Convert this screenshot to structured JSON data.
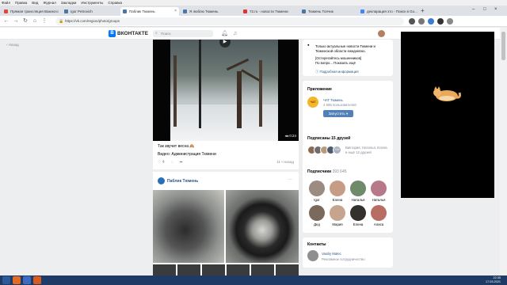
{
  "menubar": [
    "Файл",
    "Правка",
    "Вид",
    "Журнал",
    "Закладки",
    "Инструменты",
    "Справка"
  ],
  "tabs": [
    {
      "title": "Прямая трансляция Важного",
      "active": false
    },
    {
      "title": "Igor Petrovich",
      "active": false
    },
    {
      "title": "Паблик Тюмень",
      "active": true
    },
    {
      "title": "Я люблю Тюмень",
      "active": false
    },
    {
      "title": "72.ru - новости Тюмени",
      "active": false
    },
    {
      "title": "Тюмень Топчик",
      "active": false
    },
    {
      "title": "декларация это - Поиск в Go...",
      "active": false
    }
  ],
  "address": {
    "url": "https://vk.com/region/photo/groups"
  },
  "vk": {
    "logo": "ВКОНТАКТЕ",
    "search_placeholder": "Поиск"
  },
  "back_link": "Назад",
  "post1": {
    "duration": "0:24",
    "text": "Так звучит весна 🙈",
    "source": "Видео: Администрация Тюмени",
    "likes": "4",
    "time": "11 ч назад"
  },
  "post2": {
    "author": "Паблик Тюмень"
  },
  "info": {
    "line1": "Только актуальные новости Тюмени и",
    "line2": "Тюменской области ежедневно.",
    "line3": "[Остерегайтесь мошенников]",
    "line4": "По вопро... Показать ещё",
    "more": "Подробная информация"
  },
  "app": {
    "heading": "Приложение",
    "icon": "ЧАТ",
    "name": "ЧАТ Тюмень",
    "users": "4 595 пользователей",
    "button": "Запустить"
  },
  "friends": {
    "heading": "Подписаны 15 друзей",
    "extra": "+12",
    "names": "Виктория, Наталья, Елена",
    "more": "и ещё 12 друзей"
  },
  "subscribers": {
    "heading": "Подписчики",
    "count": "393 645",
    "people": [
      {
        "name": "Igor"
      },
      {
        "name": "Елена"
      },
      {
        "name": "Наталья"
      },
      {
        "name": "Наталья"
      },
      {
        "name": "Дед"
      },
      {
        "name": "Мария"
      },
      {
        "name": "Елена"
      },
      {
        "name": "Алиса"
      }
    ]
  },
  "contacts": {
    "heading": "Контакты",
    "name": "Vasiliy Malec",
    "role": "Рекламное сотрудничество"
  },
  "clock": {
    "time": "22:35",
    "date": "17.03.2021"
  }
}
